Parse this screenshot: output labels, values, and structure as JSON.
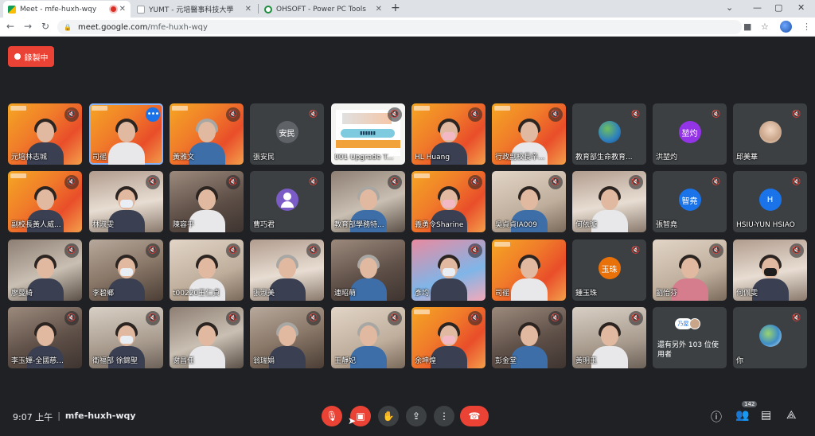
{
  "browser": {
    "tabs": [
      {
        "title": "Meet - mfe-huxh-wqy",
        "active": true
      },
      {
        "title": "YUMT - 元培醫事科技大學",
        "active": false
      },
      {
        "title": "OHSOFT - Power PC Tools",
        "active": false
      }
    ],
    "url_host": "meet.google.com",
    "url_path": "/mfe-huxh-wqy"
  },
  "meet": {
    "recording_label": "錄製中",
    "participants": [
      {
        "name": "元培林志城",
        "type": "video-banner",
        "muted": true
      },
      {
        "name": "司徭",
        "type": "video-banner",
        "muted": false,
        "selected": true
      },
      {
        "name": "黃雅文",
        "type": "video-banner",
        "muted": true
      },
      {
        "name": "張安民",
        "type": "avatar-text",
        "avatar": "安民",
        "color": "#5f6368",
        "muted": true
      },
      {
        "name": "001 Upgrade T...",
        "type": "slide",
        "muted": true
      },
      {
        "name": "HL Huang",
        "type": "video-banner",
        "muted": true
      },
      {
        "name": "行政副校長辛...",
        "type": "video-banner",
        "muted": true
      },
      {
        "name": "教育部生命教育...",
        "type": "avatar-image",
        "muted": true
      },
      {
        "name": "洪堃灼",
        "type": "avatar-text",
        "avatar": "堃灼",
        "color": "#9334e6",
        "muted": true
      },
      {
        "name": "邱美華",
        "type": "avatar-girl",
        "muted": true
      },
      {
        "name": "副校長黃人威...",
        "type": "video-banner",
        "muted": true
      },
      {
        "name": "林淑雯",
        "type": "video",
        "muted": true
      },
      {
        "name": "陳容平",
        "type": "video",
        "muted": true
      },
      {
        "name": "曹巧君",
        "type": "avatar-person",
        "muted": true
      },
      {
        "name": "教育部學務特...",
        "type": "video",
        "muted": true
      },
      {
        "name": "義勇令Sharine",
        "type": "video-banner",
        "muted": true
      },
      {
        "name": "吳貞貞IA009",
        "type": "video",
        "muted": true
      },
      {
        "name": "何依璇",
        "type": "video",
        "muted": true
      },
      {
        "name": "張智堯",
        "type": "avatar-text",
        "avatar": "智堯",
        "color": "#1a73e8",
        "muted": true
      },
      {
        "name": "HSIU-YUN HSIAO",
        "type": "avatar-text",
        "avatar": "H",
        "color": "#1a73e8",
        "muted": true
      },
      {
        "name": "廖曼綺",
        "type": "video",
        "muted": true
      },
      {
        "name": "李碧鄉",
        "type": "video",
        "muted": true
      },
      {
        "name": "t00220王仁貞",
        "type": "video",
        "muted": true
      },
      {
        "name": "張淑美",
        "type": "video",
        "muted": true
      },
      {
        "name": "連昭萌",
        "type": "video",
        "muted": false
      },
      {
        "name": "彥均",
        "type": "video-pink",
        "muted": true
      },
      {
        "name": "司徭",
        "type": "video-banner",
        "muted": false
      },
      {
        "name": "鍾玉珠",
        "type": "avatar-text",
        "avatar": "玉珠",
        "color": "#e8710a",
        "muted": true
      },
      {
        "name": "劉怡芬",
        "type": "video",
        "muted": true
      },
      {
        "name": "何佩雯",
        "type": "video",
        "muted": true
      },
      {
        "name": "李玉嬋-全國慈...",
        "type": "video",
        "muted": true
      },
      {
        "name": "衛福部 徐錦聖",
        "type": "video",
        "muted": true
      },
      {
        "name": "謝昌任",
        "type": "video",
        "muted": true
      },
      {
        "name": "翁瑞娟",
        "type": "video",
        "muted": true
      },
      {
        "name": "王靜妃",
        "type": "video",
        "muted": true
      },
      {
        "name": "余坤煌",
        "type": "video-banner",
        "muted": true
      },
      {
        "name": "彭金堂",
        "type": "video",
        "muted": true
      },
      {
        "name": "黃明玉",
        "type": "video",
        "muted": true
      },
      {
        "name": "還有另外 103 位使用者",
        "type": "more",
        "badge": "乃屋",
        "muted": false
      },
      {
        "name": "你",
        "type": "avatar-earth",
        "muted": true
      }
    ],
    "bottom": {
      "time": "9:07 上午",
      "separator": "|",
      "meeting_code": "mfe-huxh-wqy",
      "participant_count": "142"
    }
  },
  "icons": {
    "mic_off": "🎙",
    "accent_red": "#ea4335"
  }
}
